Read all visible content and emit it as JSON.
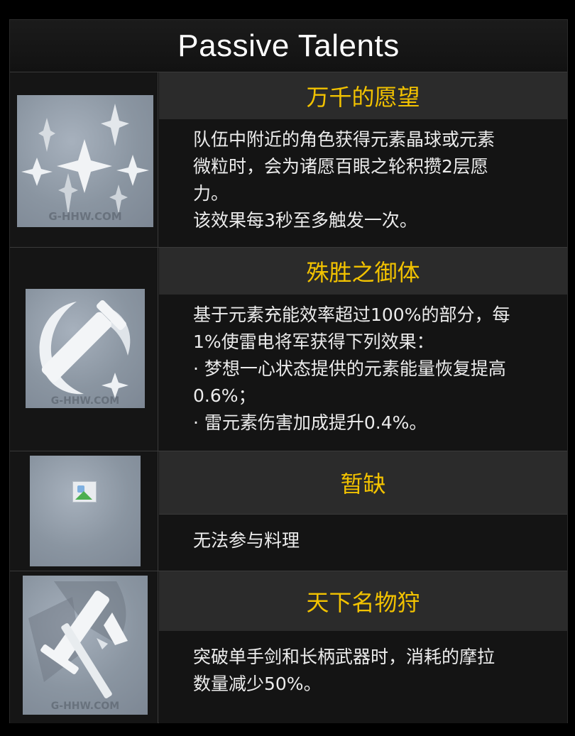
{
  "title": "Passive Talents",
  "watermark": "G-HHW.COM",
  "talents": [
    {
      "name": "万千的愿望",
      "icon": "sparkles-icon",
      "lines": [
        "队伍中附近的角色获得元素晶球或元素",
        "微粒时，会为诸愿百眼之轮积攒2层愿",
        "力。",
        "该效果每3秒至多触发一次。"
      ]
    },
    {
      "name": "殊胜之御体",
      "icon": "sword-crescent-icon",
      "lines": [
        "基于元素充能效率超过100%的部分，每",
        "1%使雷电将军获得下列效果：",
        "· 梦想一心状态提供的元素能量恢复提高",
        "0.6%；",
        "· 雷元素伤害加成提升0.4%。"
      ]
    },
    {
      "name": "暂缺",
      "icon": "broken-image-icon",
      "lines": [
        "无法参与料理"
      ]
    },
    {
      "name": "天下名物狩",
      "icon": "crossed-weapons-icon",
      "lines": [
        "突破单手剑和长柄武器时，消耗的摩拉",
        "数量减少50%。"
      ]
    }
  ],
  "colors": {
    "title": "#ffffff",
    "name": "#f2c200",
    "description": "#ececec",
    "name_bg": "#2b2b2b",
    "panel_bg": "#141414"
  }
}
